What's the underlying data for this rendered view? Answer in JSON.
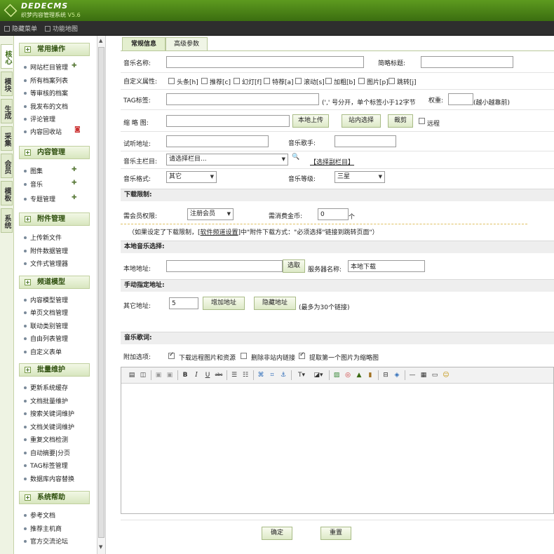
{
  "header": {
    "logo_name": "DEDECMS",
    "logo_sub": "织梦内容管理系统",
    "version": "V5.6"
  },
  "toolbar": {
    "hide_menu": "隐藏菜单",
    "function_map": "功能地图"
  },
  "left_tabs": [
    "核心",
    "模块",
    "生成",
    "采集",
    "会员",
    "模板",
    "系统"
  ],
  "sidebar": {
    "sections": [
      {
        "title": "常用操作",
        "items": [
          "网站栏目管理",
          "所有档案列表",
          "等审核的档案",
          "我发布的文档",
          "评论管理",
          "内容回收站"
        ]
      },
      {
        "title": "内容管理",
        "items": [
          "图集",
          "音乐",
          "专题管理"
        ]
      },
      {
        "title": "附件管理",
        "items": [
          "上传新文件",
          "附件数据管理",
          "文件式管理器"
        ]
      },
      {
        "title": "频道模型",
        "items": [
          "内容模型管理",
          "单页文档管理",
          "联动类别管理",
          "自由列表管理",
          "自定义表单"
        ]
      },
      {
        "title": "批量维护",
        "items": [
          "更新系统缓存",
          "文档批量维护",
          "搜索关键词维护",
          "文档关键词维护",
          "重复文档检测",
          "自动摘要|分页",
          "TAG标签管理",
          "数据库内容替换"
        ]
      },
      {
        "title": "系统帮助",
        "items": [
          "参考文档",
          "推荐主机商",
          "官方交流论坛"
        ]
      }
    ]
  },
  "tabs": [
    "常规信息",
    "高级参数"
  ],
  "form": {
    "music_name_label": "音乐名称:",
    "music_name_value": "",
    "short_title_label": "简略标题:",
    "short_title_value": "",
    "custom_attr_label": "自定义属性:",
    "custom_attrs": [
      {
        "label": "头条[h]",
        "checked": false
      },
      {
        "label": "推荐[c]",
        "checked": false
      },
      {
        "label": "幻灯[f]",
        "checked": false
      },
      {
        "label": "特荐[a]",
        "checked": false
      },
      {
        "label": "滚动[s]",
        "checked": false
      },
      {
        "label": "加粗[b]",
        "checked": false
      },
      {
        "label": "图片[p]",
        "checked": false
      },
      {
        "label": "跳转[j]",
        "checked": false
      }
    ],
    "tag_label": "TAG标签:",
    "tag_value": "",
    "tag_hint": "(',' 号分开，单个标签小于12字节",
    "weight_label": "权重:",
    "weight_value": "",
    "weight_hint": "(越小越靠前)",
    "thumb_label": "缩 略 图:",
    "thumb_value": "",
    "local_upload": "本地上传",
    "site_select": "站内选择",
    "crop": "裁剪",
    "remote_label": "远程",
    "audition_label": "试听地址:",
    "audition_value": "",
    "singer_label": "音乐歌手:",
    "singer_value": "",
    "main_column_label": "音乐主栏目:",
    "main_column_value": "请选择栏目...",
    "select_sub_column": "【选择副栏目】",
    "format_label": "音乐格式:",
    "format_value": "其它",
    "grade_label": "音乐等级:",
    "grade_value": "三星",
    "download_limit_band": "下载限制:",
    "member_perm_label": "需会员权限:",
    "member_perm_value": "注册会员",
    "coins_label": "需消费金币:",
    "coins_value": "0",
    "coins_unit": "个",
    "note_prefix": "（如果设定了下载限制，[",
    "note_link": "软件频道设置",
    "note_suffix": "]中\"附件下载方式：\"必须选择\"链接到跳转页面\"）",
    "local_music_band": "本地音乐选择:",
    "local_addr_label": "本地地址:",
    "local_addr_value": "",
    "pick_button": "选取",
    "server_name_label": "服务器名称:",
    "server_name_value": "本地下载",
    "manual_addr_band": "手动指定地址:",
    "other_addr_label": "其它地址:",
    "other_addr_value": "5",
    "add_addr_button": "增加地址",
    "hide_addr_button": "隐藏地址",
    "max_links_hint": "(最多为30个链接)",
    "lyrics_band": "音乐歌词:",
    "extra_options_label": "附加选项:",
    "extra_options": [
      {
        "label": "下载远程图片和资源",
        "checked": true
      },
      {
        "label": "删除非站内链接",
        "checked": false
      },
      {
        "label": "提取第一个图片为缩略图",
        "checked": true
      }
    ],
    "confirm_button": "确定",
    "reset_button": "重置"
  },
  "editor_toolbar": [
    "source-icon",
    "preview-icon",
    "paste-icon",
    "paste-text-icon",
    "bold-icon",
    "italic-icon",
    "underline-icon",
    "strike-icon",
    "ordered-list-icon",
    "unordered-list-icon",
    "link-icon",
    "unlink-icon",
    "anchor-icon",
    "font-color-icon",
    "bg-color-icon",
    "image-icon",
    "flash-icon",
    "media-icon",
    "file-icon",
    "page-break-icon",
    "code-icon",
    "hr-icon",
    "table-icon",
    "fullscreen-icon",
    "smiley-icon"
  ]
}
